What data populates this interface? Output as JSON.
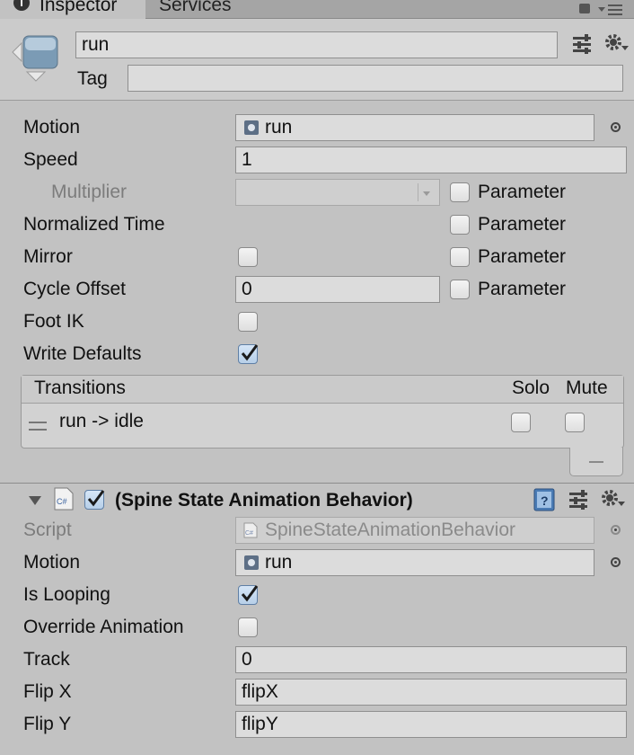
{
  "tabs": [
    {
      "label": "Inspector"
    },
    {
      "label": "Services"
    }
  ],
  "header": {
    "name_value": "run",
    "tag_label": "Tag",
    "tag_value": ""
  },
  "state": {
    "motion_label": "Motion",
    "motion_value": "run",
    "speed_label": "Speed",
    "speed_value": "1",
    "multiplier_label": "Multiplier",
    "parameter_label": "Parameter",
    "normalized_time_label": "Normalized Time",
    "mirror_label": "Mirror",
    "cycle_offset_label": "Cycle Offset",
    "cycle_offset_value": "0",
    "foot_ik_label": "Foot IK",
    "write_defaults_label": "Write Defaults",
    "write_defaults_checked": true
  },
  "transitions": {
    "header_label": "Transitions",
    "solo_label": "Solo",
    "mute_label": "Mute",
    "items": [
      {
        "label": "run -> idle"
      }
    ],
    "remove_label": "—"
  },
  "behavior": {
    "script_type_icon_text": "C#",
    "title": "(Spine State Animation Behavior)",
    "enabled": true,
    "script_label": "Script",
    "script_value": "SpineStateAnimationBehavior",
    "motion_label": "Motion",
    "motion_value": "run",
    "is_looping_label": "Is Looping",
    "is_looping_checked": true,
    "override_animation_label": "Override Animation",
    "track_label": "Track",
    "track_value": "0",
    "flip_x_label": "Flip X",
    "flip_x_value": "flipX",
    "flip_y_label": "Flip Y",
    "flip_y_value": "flipY"
  }
}
